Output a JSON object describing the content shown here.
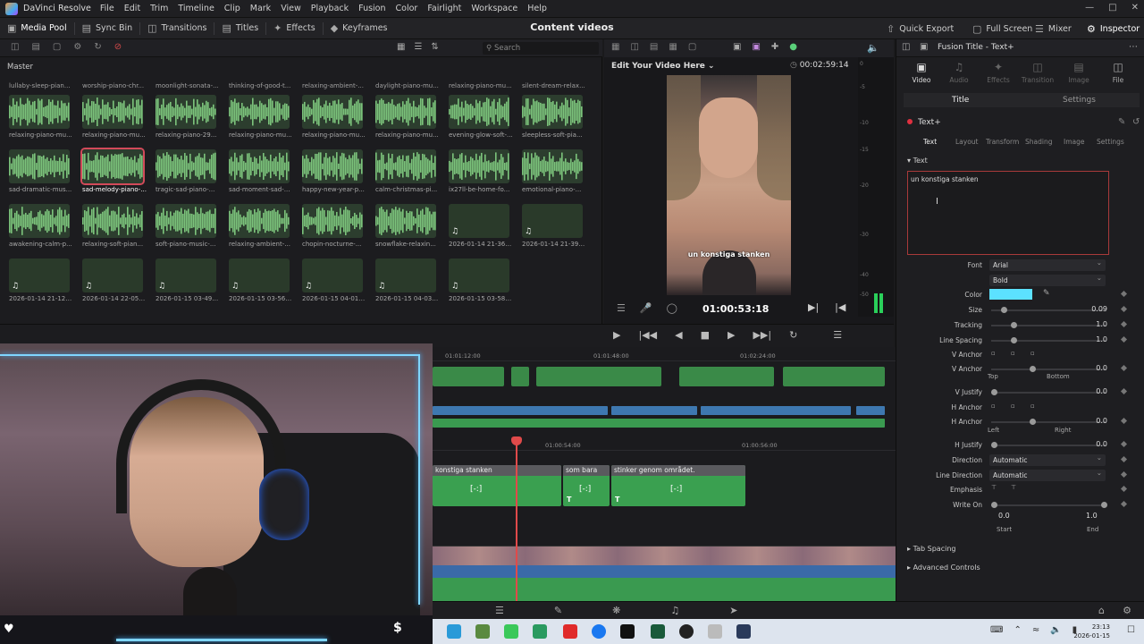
{
  "app": {
    "name": "DaVinci Resolve"
  },
  "menu": [
    "File",
    "Edit",
    "Trim",
    "Timeline",
    "Clip",
    "Mark",
    "View",
    "Playback",
    "Fusion",
    "Color",
    "Fairlight",
    "Workspace",
    "Help"
  ],
  "toolbar": {
    "media_pool": "Media Pool",
    "sync_bin": "Sync Bin",
    "transitions": "Transitions",
    "titles": "Titles",
    "effects": "Effects",
    "keyframes": "Keyframes",
    "project_title": "Content videos",
    "quick_export": "Quick Export",
    "full_screen": "Full Screen",
    "mixer": "Mixer",
    "inspector": "Inspector"
  },
  "media_pool": {
    "search_placeholder": "Search",
    "bin": "Master",
    "top_labels": [
      "lullaby-sleep-pian...",
      "worship-piano-chr...",
      "moonlight-sonata-...",
      "thinking-of-good-t...",
      "relaxing-ambient-...",
      "daylight-piano-mu...",
      "relaxing-piano-mu...",
      "silent-dream-relax..."
    ],
    "clips": [
      "relaxing-piano-mu...",
      "relaxing-piano-mu...",
      "relaxing-piano-29...",
      "relaxing-piano-mu...",
      "relaxing-piano-mu...",
      "relaxing-piano-mu...",
      "evening-glow-soft-...",
      "sleepless-soft-pia...",
      "sad-dramatic-mus...",
      "sad-melody-piano-...",
      "tragic-sad-piano-...",
      "sad-moment-sad-...",
      "happy-new-year-p...",
      "calm-christmas-pi...",
      "ix27ll-be-home-fo...",
      "emotional-piano-...",
      "awakening-calm-p...",
      "relaxing-soft-pian...",
      "soft-piano-music-...",
      "relaxing-ambient-...",
      "chopin-nocturne-...",
      "snowflake-relaxin...",
      "2026-01-14 21-36-...",
      "2026-01-14 21-39-...",
      "2026-01-14 21-12-...",
      "2026-01-14 22-05-...",
      "2026-01-15 03-49-...",
      "2026-01-15 03-56-...",
      "2026-01-15 04-01-...",
      "2026-01-15 04-03-...",
      "2026-01-15 03-58-..."
    ],
    "selected_clip": "sad-melody-piano-..."
  },
  "viewer": {
    "title": "Edit Your Video Here",
    "duration": "00:02:59:14",
    "timecode": "01:00:53:18",
    "subtitle": "un konstiga stanken",
    "meter_levels": [
      "0",
      "-5",
      "-10",
      "-15",
      "-20",
      "-30",
      "-40",
      "-50"
    ]
  },
  "inspector": {
    "panel_title": "Fusion Title - Text+",
    "tabs": [
      "Video",
      "Audio",
      "Effects",
      "Transition",
      "Image",
      "File"
    ],
    "subtabs": [
      "Title",
      "Settings"
    ],
    "node": "Text+",
    "text_tabs": [
      "Text",
      "Layout",
      "Transform",
      "Shading",
      "Image",
      "Settings"
    ],
    "section": "Text",
    "text_value": "un konstiga stanken",
    "font": "Arial",
    "style": "Bold",
    "color_label": "Color",
    "color": "#5ce1ff",
    "size_label": "Size",
    "size": "0.09",
    "size_frac": 0.09,
    "tracking_label": "Tracking",
    "tracking": "1.0",
    "tracking_frac": 0.18,
    "line_spacing_label": "Line Spacing",
    "line_spacing": "1.0",
    "line_spacing_frac": 0.18,
    "v_anchor_label": "V Anchor",
    "v_anchor_value": "0.0",
    "v_anchor_frac": 0.35,
    "top": "Top",
    "bottom": "Bottom",
    "v_justify_label": "V Justify",
    "v_justify": "0.0",
    "h_anchor_label": "H Anchor",
    "h_anchor_value": "0.0",
    "left": "Left",
    "right": "Right",
    "h_justify_label": "H Justify",
    "h_justify": "0.0",
    "direction_label": "Direction",
    "direction": "Automatic",
    "line_direction_label": "Line Direction",
    "line_direction": "Automatic",
    "emphasis_label": "Emphasis",
    "write_on_label": "Write On",
    "start_value": "0.0",
    "end_value": "1.0",
    "start": "Start",
    "end": "End",
    "font_label": "Font",
    "tab_spacing": "Tab Spacing",
    "advanced": "Advanced Controls"
  },
  "timeline": {
    "ruler_top": [
      "01:01:12:00",
      "01:01:48:00",
      "01:02:24:00"
    ],
    "ruler_main": [
      "01:00:54:00",
      "01:00:56:00"
    ],
    "title_clips": [
      "konstiga stanken",
      "som bara",
      "stinker genom området."
    ],
    "title_glyph": "[-:]"
  },
  "taskbar": {
    "time": "23:13",
    "date": "2026-01-15"
  }
}
